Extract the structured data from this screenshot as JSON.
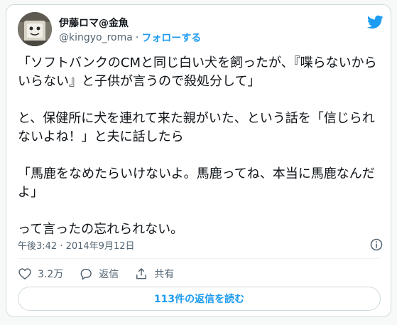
{
  "author": {
    "display_name": "伊藤ロマ@金魚",
    "handle": "@kingyo_roma",
    "separator": "·",
    "follow_label": "フォローする"
  },
  "tweet": {
    "paragraphs": [
      "「ソフトバンクのCMと同じ白い犬を飼ったが、『喋らないからいらない』と子供が言うので殺処分して」",
      "と、保健所に犬を連れて来た親がいた、という話を「信じられないよね！」と夫に話したら",
      "「馬鹿をなめたらいけないよ。馬鹿ってね、本当に馬鹿なんだよ」",
      "って言ったの忘れられない。"
    ],
    "timestamp": "午後3:42 · 2014年9月12日"
  },
  "actions": {
    "like_count": "3.2万",
    "reply_label": "返信",
    "share_label": "共有"
  },
  "replies_button": {
    "label": "113件の返信を読む"
  },
  "colors": {
    "accent": "#1d9bf0",
    "secondary_text": "#536471",
    "border": "#cfd9de"
  },
  "icons": {
    "brand": "twitter-bird-icon",
    "info": "info-icon",
    "like": "heart-icon",
    "reply": "speech-bubble-icon",
    "share": "share-upload-icon"
  }
}
